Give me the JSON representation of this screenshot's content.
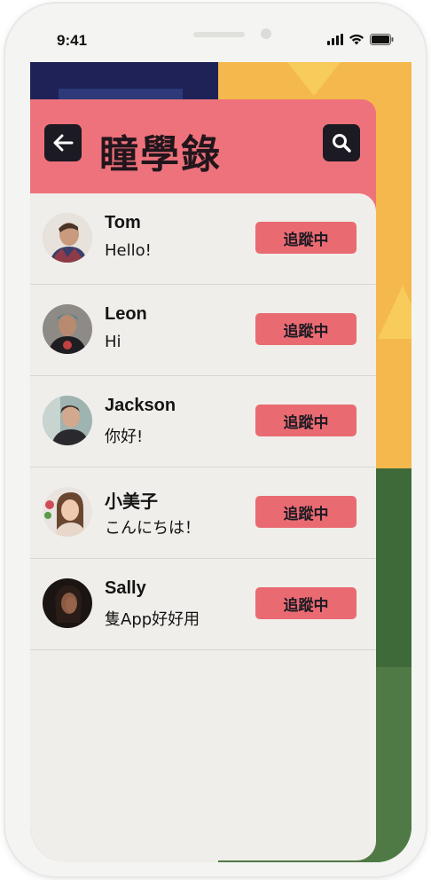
{
  "status": {
    "time": "9:41"
  },
  "header": {
    "title": "瞳學錄",
    "back_icon": "arrow-left-icon",
    "search_icon": "search-icon"
  },
  "users": [
    {
      "name": "Tom",
      "message": "Hello!",
      "follow_label": "追蹤中"
    },
    {
      "name": "Leon",
      "message": "Hi",
      "follow_label": "追蹤中"
    },
    {
      "name": "Jackson",
      "message": "你好!",
      "follow_label": "追蹤中"
    },
    {
      "name": "小美子",
      "message": "こんにちは！",
      "follow_label": "追蹤中"
    },
    {
      "name": "Sally",
      "message": "隻App好好用",
      "follow_label": "追蹤中"
    }
  ],
  "colors": {
    "accent": "#ee727b",
    "button": "#ea6a72",
    "dark": "#1c1a22",
    "panel": "#f0eeea"
  }
}
